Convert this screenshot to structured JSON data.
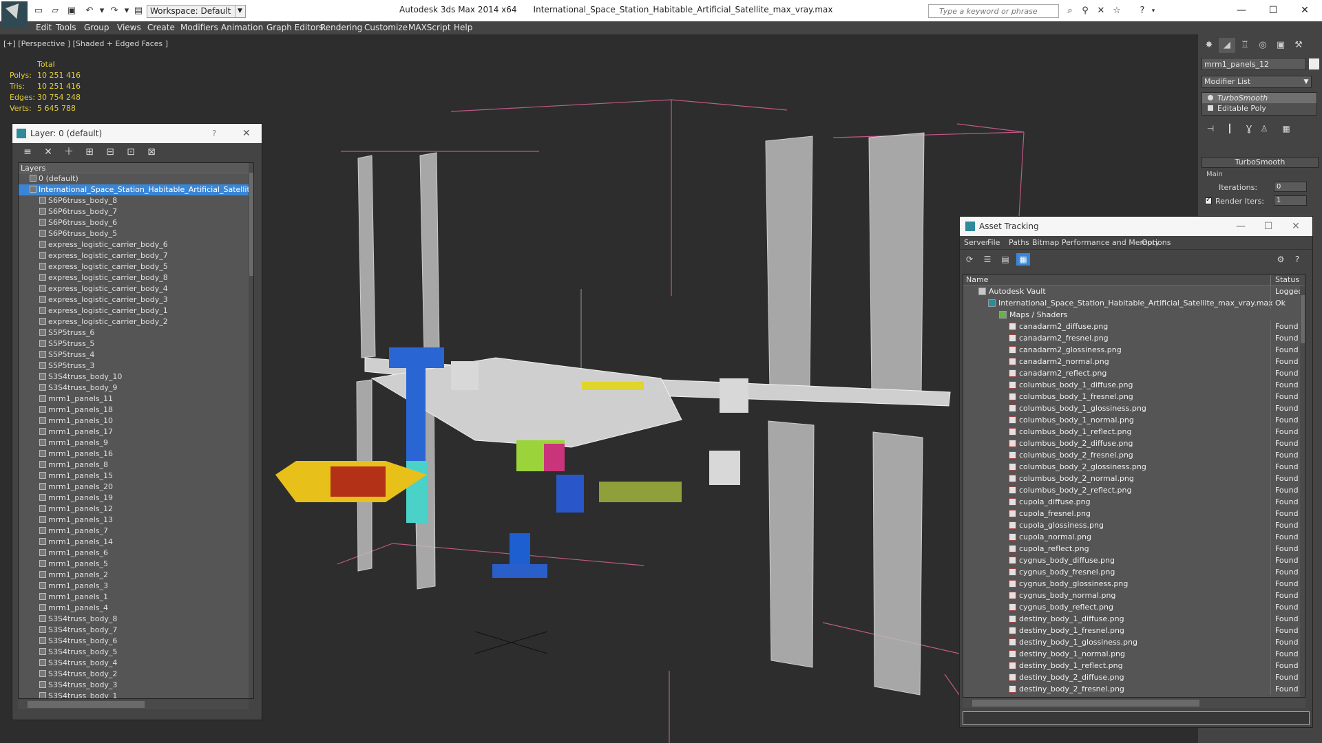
{
  "titlebar": {
    "workspace": "Workspace: Default",
    "app_name": "Autodesk 3ds Max  2014 x64",
    "file_name": "International_Space_Station_Habitable_Artificial_Satellite_max_vray.max",
    "search_placeholder": "Type a keyword or phrase"
  },
  "menu": [
    "Edit",
    "Tools",
    "Group",
    "Views",
    "Create",
    "Modifiers",
    "Animation",
    "Graph Editors",
    "Rendering",
    "Customize",
    "MAXScript",
    "Help"
  ],
  "viewport": {
    "label": "[+] [Perspective ] [Shaded + Edged Faces ]",
    "stats_header": "Total",
    "stats": [
      {
        "key": "Polys:",
        "value": "10 251 416"
      },
      {
        "key": "Tris:",
        "value": "10 251 416"
      },
      {
        "key": "Edges:",
        "value": "30 754 248"
      },
      {
        "key": "Verts:",
        "value": "5 645 788"
      }
    ]
  },
  "layer_panel": {
    "title": "Layer: 0 (default)",
    "help": "?",
    "list_header": "Layers",
    "rows": [
      {
        "label": "0 (default)",
        "indent": 1,
        "selected": false
      },
      {
        "label": "International_Space_Station_Habitable_Artificial_Satellite",
        "indent": 1,
        "selected": true
      },
      {
        "label": "S6P6truss_body_8",
        "indent": 2,
        "selected": false
      },
      {
        "label": "S6P6truss_body_7",
        "indent": 2,
        "selected": false
      },
      {
        "label": "S6P6truss_body_6",
        "indent": 2,
        "selected": false
      },
      {
        "label": "S6P6truss_body_5",
        "indent": 2,
        "selected": false
      },
      {
        "label": "express_logistic_carrier_body_6",
        "indent": 2,
        "selected": false
      },
      {
        "label": "express_logistic_carrier_body_7",
        "indent": 2,
        "selected": false
      },
      {
        "label": "express_logistic_carrier_body_5",
        "indent": 2,
        "selected": false
      },
      {
        "label": "express_logistic_carrier_body_8",
        "indent": 2,
        "selected": false
      },
      {
        "label": "express_logistic_carrier_body_4",
        "indent": 2,
        "selected": false
      },
      {
        "label": "express_logistic_carrier_body_3",
        "indent": 2,
        "selected": false
      },
      {
        "label": "express_logistic_carrier_body_1",
        "indent": 2,
        "selected": false
      },
      {
        "label": "express_logistic_carrier_body_2",
        "indent": 2,
        "selected": false
      },
      {
        "label": "S5P5truss_6",
        "indent": 2,
        "selected": false
      },
      {
        "label": "S5P5truss_5",
        "indent": 2,
        "selected": false
      },
      {
        "label": "S5P5truss_4",
        "indent": 2,
        "selected": false
      },
      {
        "label": "S5P5truss_3",
        "indent": 2,
        "selected": false
      },
      {
        "label": "S3S4truss_body_10",
        "indent": 2,
        "selected": false
      },
      {
        "label": "S3S4truss_body_9",
        "indent": 2,
        "selected": false
      },
      {
        "label": "mrm1_panels_11",
        "indent": 2,
        "selected": false
      },
      {
        "label": "mrm1_panels_18",
        "indent": 2,
        "selected": false
      },
      {
        "label": "mrm1_panels_10",
        "indent": 2,
        "selected": false
      },
      {
        "label": "mrm1_panels_17",
        "indent": 2,
        "selected": false
      },
      {
        "label": "mrm1_panels_9",
        "indent": 2,
        "selected": false
      },
      {
        "label": "mrm1_panels_16",
        "indent": 2,
        "selected": false
      },
      {
        "label": "mrm1_panels_8",
        "indent": 2,
        "selected": false
      },
      {
        "label": "mrm1_panels_15",
        "indent": 2,
        "selected": false
      },
      {
        "label": "mrm1_panels_20",
        "indent": 2,
        "selected": false
      },
      {
        "label": "mrm1_panels_19",
        "indent": 2,
        "selected": false
      },
      {
        "label": "mrm1_panels_12",
        "indent": 2,
        "selected": false
      },
      {
        "label": "mrm1_panels_13",
        "indent": 2,
        "selected": false
      },
      {
        "label": "mrm1_panels_7",
        "indent": 2,
        "selected": false
      },
      {
        "label": "mrm1_panels_14",
        "indent": 2,
        "selected": false
      },
      {
        "label": "mrm1_panels_6",
        "indent": 2,
        "selected": false
      },
      {
        "label": "mrm1_panels_5",
        "indent": 2,
        "selected": false
      },
      {
        "label": "mrm1_panels_2",
        "indent": 2,
        "selected": false
      },
      {
        "label": "mrm1_panels_3",
        "indent": 2,
        "selected": false
      },
      {
        "label": "mrm1_panels_1",
        "indent": 2,
        "selected": false
      },
      {
        "label": "mrm1_panels_4",
        "indent": 2,
        "selected": false
      },
      {
        "label": "S3S4truss_body_8",
        "indent": 2,
        "selected": false
      },
      {
        "label": "S3S4truss_body_7",
        "indent": 2,
        "selected": false
      },
      {
        "label": "S3S4truss_body_6",
        "indent": 2,
        "selected": false
      },
      {
        "label": "S3S4truss_body_5",
        "indent": 2,
        "selected": false
      },
      {
        "label": "S3S4truss_body_4",
        "indent": 2,
        "selected": false
      },
      {
        "label": "S3S4truss_body_2",
        "indent": 2,
        "selected": false
      },
      {
        "label": "S3S4truss_body_3",
        "indent": 2,
        "selected": false
      },
      {
        "label": "S3S4truss_body_1",
        "indent": 2,
        "selected": false
      }
    ]
  },
  "command_panel": {
    "object_name": "mrm1_panels_12",
    "modifier_list": "Modifier List",
    "stack": [
      {
        "label": "TurboSmooth",
        "selected": true
      },
      {
        "label": "Editable Poly",
        "selected": false
      }
    ],
    "rollout_title": "TurboSmooth",
    "group_main": "Main",
    "iterations_label": "Iterations:",
    "iterations_value": "0",
    "render_iters_label": "Render Iters:",
    "render_iters_value": "1"
  },
  "asset_tracking": {
    "title": "Asset Tracking",
    "menu": [
      "Server",
      "File",
      "Paths",
      "Bitmap Performance and Memory",
      "Options"
    ],
    "col_name": "Name",
    "col_status": "Status",
    "rows": [
      {
        "name": "Autodesk Vault",
        "status": "Logged",
        "level": 0,
        "icon": "vault"
      },
      {
        "name": "International_Space_Station_Habitable_Artificial_Satellite_max_vray.max",
        "status": "Ok",
        "level": 1,
        "icon": "max"
      },
      {
        "name": "Maps / Shaders",
        "status": "",
        "level": 2,
        "icon": "folder"
      },
      {
        "name": "canadarm2_diffuse.png",
        "status": "Found",
        "level": 3,
        "icon": "png"
      },
      {
        "name": "canadarm2_fresnel.png",
        "status": "Found",
        "level": 3,
        "icon": "png"
      },
      {
        "name": "canadarm2_glossiness.png",
        "status": "Found",
        "level": 3,
        "icon": "png"
      },
      {
        "name": "canadarm2_normal.png",
        "status": "Found",
        "level": 3,
        "icon": "png"
      },
      {
        "name": "canadarm2_reflect.png",
        "status": "Found",
        "level": 3,
        "icon": "png"
      },
      {
        "name": "columbus_body_1_diffuse.png",
        "status": "Found",
        "level": 3,
        "icon": "png"
      },
      {
        "name": "columbus_body_1_fresnel.png",
        "status": "Found",
        "level": 3,
        "icon": "png"
      },
      {
        "name": "columbus_body_1_glossiness.png",
        "status": "Found",
        "level": 3,
        "icon": "png"
      },
      {
        "name": "columbus_body_1_normal.png",
        "status": "Found",
        "level": 3,
        "icon": "png"
      },
      {
        "name": "columbus_body_1_reflect.png",
        "status": "Found",
        "level": 3,
        "icon": "png"
      },
      {
        "name": "columbus_body_2_diffuse.png",
        "status": "Found",
        "level": 3,
        "icon": "png"
      },
      {
        "name": "columbus_body_2_fresnel.png",
        "status": "Found",
        "level": 3,
        "icon": "png"
      },
      {
        "name": "columbus_body_2_glossiness.png",
        "status": "Found",
        "level": 3,
        "icon": "png"
      },
      {
        "name": "columbus_body_2_normal.png",
        "status": "Found",
        "level": 3,
        "icon": "png"
      },
      {
        "name": "columbus_body_2_reflect.png",
        "status": "Found",
        "level": 3,
        "icon": "png"
      },
      {
        "name": "cupola_diffuse.png",
        "status": "Found",
        "level": 3,
        "icon": "png"
      },
      {
        "name": "cupola_fresnel.png",
        "status": "Found",
        "level": 3,
        "icon": "png"
      },
      {
        "name": "cupola_glossiness.png",
        "status": "Found",
        "level": 3,
        "icon": "png"
      },
      {
        "name": "cupola_normal.png",
        "status": "Found",
        "level": 3,
        "icon": "png"
      },
      {
        "name": "cupola_reflect.png",
        "status": "Found",
        "level": 3,
        "icon": "png"
      },
      {
        "name": "cygnus_body_diffuse.png",
        "status": "Found",
        "level": 3,
        "icon": "png"
      },
      {
        "name": "cygnus_body_fresnel.png",
        "status": "Found",
        "level": 3,
        "icon": "png"
      },
      {
        "name": "cygnus_body_glossiness.png",
        "status": "Found",
        "level": 3,
        "icon": "png"
      },
      {
        "name": "cygnus_body_normal.png",
        "status": "Found",
        "level": 3,
        "icon": "png"
      },
      {
        "name": "cygnus_body_reflect.png",
        "status": "Found",
        "level": 3,
        "icon": "png"
      },
      {
        "name": "destiny_body_1_diffuse.png",
        "status": "Found",
        "level": 3,
        "icon": "png"
      },
      {
        "name": "destiny_body_1_fresnel.png",
        "status": "Found",
        "level": 3,
        "icon": "png"
      },
      {
        "name": "destiny_body_1_glossiness.png",
        "status": "Found",
        "level": 3,
        "icon": "png"
      },
      {
        "name": "destiny_body_1_normal.png",
        "status": "Found",
        "level": 3,
        "icon": "png"
      },
      {
        "name": "destiny_body_1_reflect.png",
        "status": "Found",
        "level": 3,
        "icon": "png"
      },
      {
        "name": "destiny_body_2_diffuse.png",
        "status": "Found",
        "level": 3,
        "icon": "png"
      },
      {
        "name": "destiny_body_2_fresnel.png",
        "status": "Found",
        "level": 3,
        "icon": "png"
      }
    ]
  },
  "colors": {
    "selection": "#3a86d6",
    "stats_text": "#e6d13a",
    "viewport_bg": "#2d2d2d"
  }
}
